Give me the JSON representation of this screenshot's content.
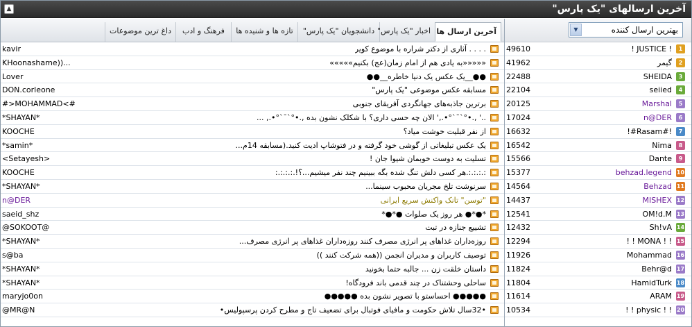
{
  "title": "آخرین ارسالهای \"یک پارس\"",
  "selector": {
    "value": "بهترین ارسال کننده"
  },
  "tabs": [
    {
      "label": "آخرین ارسال ها",
      "active": true
    },
    {
      "label": "اخبار \"یک پارس\"",
      "active": false
    },
    {
      "label": "دانشجویان \"یک پارس\"",
      "active": false
    },
    {
      "label": "تازه ها و شنیده ها",
      "active": false
    },
    {
      "label": "فرهنگ و ادب",
      "active": false
    },
    {
      "label": "داغ ترین موضوعات",
      "active": false
    }
  ],
  "posts": [
    {
      "subject": ". . . . آثاری از دکتر شراره با موضوع کویر",
      "author": "kavir"
    },
    {
      "subject": "«««««به یادی هم از امام زمان(عج) بکنیم»»»»»",
      "author": "KHoonashame))..."
    },
    {
      "subject": "●●__یک عکس یک دنیا خاطره__●●",
      "author": "Lover"
    },
    {
      "subject": "مسابقه عکس موضوعی \"یک پارس\"",
      "author": "DON.corleone"
    },
    {
      "subject": "برترین جاذبه‌های جهانگردی آفریقای جنوبی",
      "author": "#>MOHAMMAD<#"
    },
    {
      "subject": "..' ,.•°`¯`°•.,' الان چه حسی داری؟ با شکلک نشون بده ,.•°`¯`°•., ...",
      "author": "*SHAYAN*"
    },
    {
      "subject": "از نفر قبلیت خوشت میاد؟",
      "author": "KOOCHE"
    },
    {
      "subject": "یک عکس تبلیغاتی از گوشی خود گرفته و در فتوشاپ ادیت کنید.(مسابقه 14م...",
      "author": "*samin*"
    },
    {
      "subject": "تسلیت به دوست خوبمان شیوا جان !",
      "author": "<Setayesh>"
    },
    {
      "subject": ":.:.:.:.هر کسی دلش تنگ شده بگه ببینیم چند نفر میشیم...؟!.:.:.:.:",
      "author": "KOOCHE"
    },
    {
      "subject": "سرنوشت تلخ مجریان محبوب سینما...",
      "author": "*SHAYAN*"
    },
    {
      "subject": "\"توسن\" تانک واکنش سریع ایرانی",
      "author": "n@DER"
    },
    {
      "subject": "*●*● هر روز یک صلوات ●*●*",
      "author": "saeid_shz"
    },
    {
      "subject": "تشییع جنازه در تبت",
      "author": "@SOKOOT@"
    },
    {
      "subject": "روزه‌داران غذاهای پر انرژی مصرف کنند روزه‌داران غذاهای پر انرژی مصرف...",
      "author": "*SHAYAN*"
    },
    {
      "subject": "توصیف کاربران و مدیران انجمن ((همه شرکت کنند ))",
      "author": "s@ba"
    },
    {
      "subject": "داستان خلقت زن ... جالبه حتما بخونید",
      "author": "*SHAYAN*"
    },
    {
      "subject": "ساحلی وحشتناک در چند قدمی باند فرودگاه!",
      "author": "*SHAYAN*"
    },
    {
      "subject": "●●●●● احساستو با تصویر نشون بده ●●●●●",
      "author": "maryjo0on"
    },
    {
      "subject": "•32سال تلاش حکومت و مافیای فوتبال برای تضعیف تاج و مطرح کردن پرسپولیس•",
      "author": "@MR@N"
    }
  ],
  "users": [
    {
      "count": "49610",
      "name": "! JUSTICE !",
      "rank": "1",
      "rank_color": "#e0a020"
    },
    {
      "count": "41962",
      "name": "گیمر",
      "rank": "2",
      "rank_color": "#e0a020"
    },
    {
      "count": "22488",
      "name": "SHEIDA",
      "rank": "3",
      "rank_color": "#6aaa3a"
    },
    {
      "count": "22104",
      "name": "seiied",
      "rank": "4",
      "rank_color": "#6aaa3a"
    },
    {
      "count": "20125",
      "name": "Marshal",
      "rank": "5",
      "rank_color": "#9a7ac8"
    },
    {
      "count": "17024",
      "name": "n@DER",
      "rank": "6",
      "rank_color": "#9a7ac8"
    },
    {
      "count": "16632",
      "name": "!#Rasam#!",
      "rank": "7",
      "rank_color": "#4a8ac8"
    },
    {
      "count": "16542",
      "name": "Nima",
      "rank": "8",
      "rank_color": "#c85a8a"
    },
    {
      "count": "15566",
      "name": "Dante",
      "rank": "9",
      "rank_color": "#c85a8a"
    },
    {
      "count": "15377",
      "name": "behzad.legend",
      "rank": "10",
      "rank_color": "#e07a20"
    },
    {
      "count": "14564",
      "name": "Behzad",
      "rank": "11",
      "rank_color": "#e07a20"
    },
    {
      "count": "14437",
      "name": "MISHEX",
      "rank": "12",
      "rank_color": "#9a7ac8"
    },
    {
      "count": "12541",
      "name": "OM!d.M",
      "rank": "13",
      "rank_color": "#9a7ac8"
    },
    {
      "count": "12432",
      "name": "Sh!vA",
      "rank": "14",
      "rank_color": "#6aaa3a"
    },
    {
      "count": "12294",
      "name": "! ! MONA ! !",
      "rank": "15",
      "rank_color": "#c85a8a"
    },
    {
      "count": "11926",
      "name": "Mohammad",
      "rank": "16",
      "rank_color": "#9a7ac8"
    },
    {
      "count": "11824",
      "name": "Behr@d",
      "rank": "17",
      "rank_color": "#9a7ac8"
    },
    {
      "count": "11804",
      "name": "HamidTurk",
      "rank": "18",
      "rank_color": "#4a8ac8"
    },
    {
      "count": "11614",
      "name": "ARAM",
      "rank": "19",
      "rank_color": "#c85a8a"
    },
    {
      "count": "10534",
      "name": "! ! physic ! !",
      "rank": "20",
      "rank_color": "#9a7ac8"
    }
  ],
  "colors": {
    "purple_names": [
      "Marshal",
      "n@DER",
      "behzad.legend",
      "Behzad",
      "MISHEX"
    ],
    "highlight_post": "\"توسن\" تانک واکنش سریع ایرانی"
  }
}
